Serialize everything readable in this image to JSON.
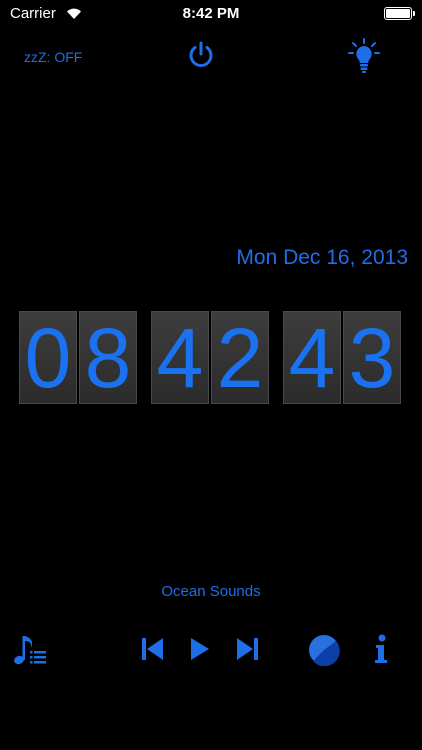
{
  "status_bar": {
    "carrier": "Carrier",
    "time": "8:42 PM"
  },
  "top_controls": {
    "sleep_timer": "zzZ: OFF"
  },
  "clock": {
    "date": "Mon Dec 16, 2013",
    "digits": [
      "0",
      "8",
      "4",
      "2",
      "4",
      "3"
    ]
  },
  "player": {
    "track_name": "Ocean Sounds"
  },
  "icons": [
    "wifi-icon",
    "battery-icon",
    "power-icon",
    "lightbulb-icon",
    "music-playlist-icon",
    "skip-previous-icon",
    "play-icon",
    "skip-next-icon",
    "color-wheel-icon",
    "info-icon"
  ],
  "colors": {
    "accent": "#1e6ee8",
    "background": "#000000",
    "digit_panel": "#333333"
  }
}
